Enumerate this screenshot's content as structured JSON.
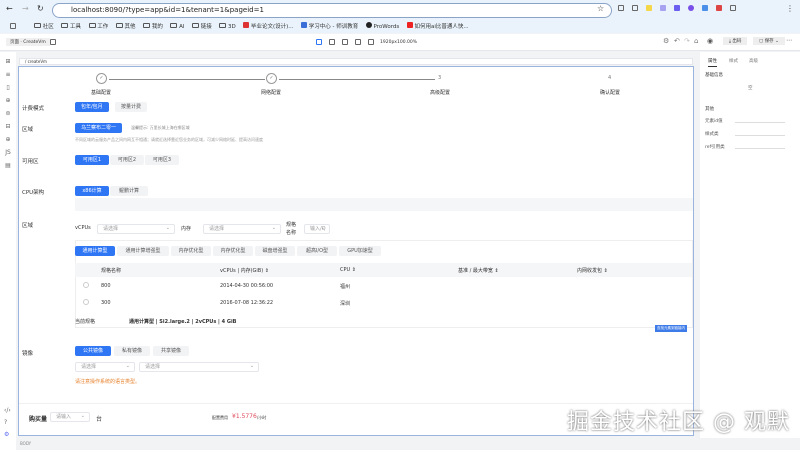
{
  "browser": {
    "url": "localhost:8090/?type=app&id=1&tenant=1&pageid=1",
    "bookmarks": [
      "社区",
      "工具",
      "工作",
      "其他",
      "我的",
      "AI",
      "链接",
      "3D",
      "毕业论文(设计)...",
      "学习中心 - 师训教育",
      "ProWords",
      "如何用ai比普通人快..."
    ]
  },
  "toolbar": {
    "breadcrumb": "页面 · CreateVm",
    "resolution": "1920px",
    "zoom": "100.00%",
    "export": "出码",
    "save": "保存"
  },
  "canvas": {
    "path": "/ createVm",
    "body_label": "BODY"
  },
  "steps": [
    {
      "num": "✓",
      "label": "基础配置"
    },
    {
      "num": "✓",
      "label": "网络配置"
    },
    {
      "num": "3",
      "label": "高级配置"
    },
    {
      "num": "4",
      "label": "确认配置"
    }
  ],
  "billing": {
    "label": "计费模式",
    "options": [
      "包年/包月",
      "按量计费"
    ]
  },
  "region": {
    "label": "区域",
    "selected": "乌兰察布二零一",
    "hint": "温馨提示: 万里长城上海在哪区域",
    "note": "不同区域的云服务产品之间内网互不相通；请就近选择靠近您业务的区域，可减少网络时延、提高访问速度"
  },
  "zone": {
    "label": "可用区",
    "options": [
      "可用区1",
      "可用区2",
      "可用区3"
    ]
  },
  "cpu_arch": {
    "label": "CPU架构",
    "options": [
      "x86计算",
      "鲲鹏计算"
    ]
  },
  "spec": {
    "label": "区域",
    "vcpu_label": "vCPUs",
    "vcpu_placeholder": "请选择",
    "mem_label": "内存",
    "mem_placeholder": "请选择",
    "name_label": "规格名称",
    "name_placeholder": "输入/Q",
    "tabs": [
      "通用计算型",
      "通用计算增强型",
      "内存优化型",
      "内存优化型",
      "磁盘增强型",
      "超高I/O型",
      "GPU加速型"
    ],
    "columns": [
      "规格名称",
      "vCPUs | 内存(GiB) ⇕",
      "CPU ⇕",
      "基准 / 最大带宽 ⇕",
      "内网收发包 ⇕"
    ],
    "rows": [
      [
        "800",
        "2014-04-30 00:56:00",
        "福州"
      ],
      [
        "300",
        "2016-07-08 12:36:22",
        "深圳"
      ]
    ],
    "current_label": "当前规格",
    "current_value": "通用计算型 | Si2.large.2 | 2vCPUs | 4 GiB",
    "tag": "查找元素到链接内"
  },
  "image": {
    "label": "镜像",
    "options": [
      "公共镜像",
      "私有镜像",
      "共享镜像"
    ],
    "select1": "请选择",
    "select2": "请选择",
    "warning": "请注意操作系统的语言类型。"
  },
  "purchase": {
    "label": "购买量",
    "placeholder": "请输入",
    "unit": "台",
    "fee_label": "配置费用",
    "fee": "¥1.5776",
    "fee_unit": "/小时"
  },
  "panel": {
    "tabs": [
      "属性",
      "样式",
      "高级"
    ],
    "section1": "基础信息",
    "empty": "空",
    "section2": "其他",
    "fields": [
      "元素id值",
      "样式类",
      "ref引用类"
    ]
  },
  "watermark": "掘金技术社区 @ 观默",
  "colors": {
    "primary": "#2f76f5",
    "warning": "#e6822e",
    "price": "#e0485a"
  }
}
